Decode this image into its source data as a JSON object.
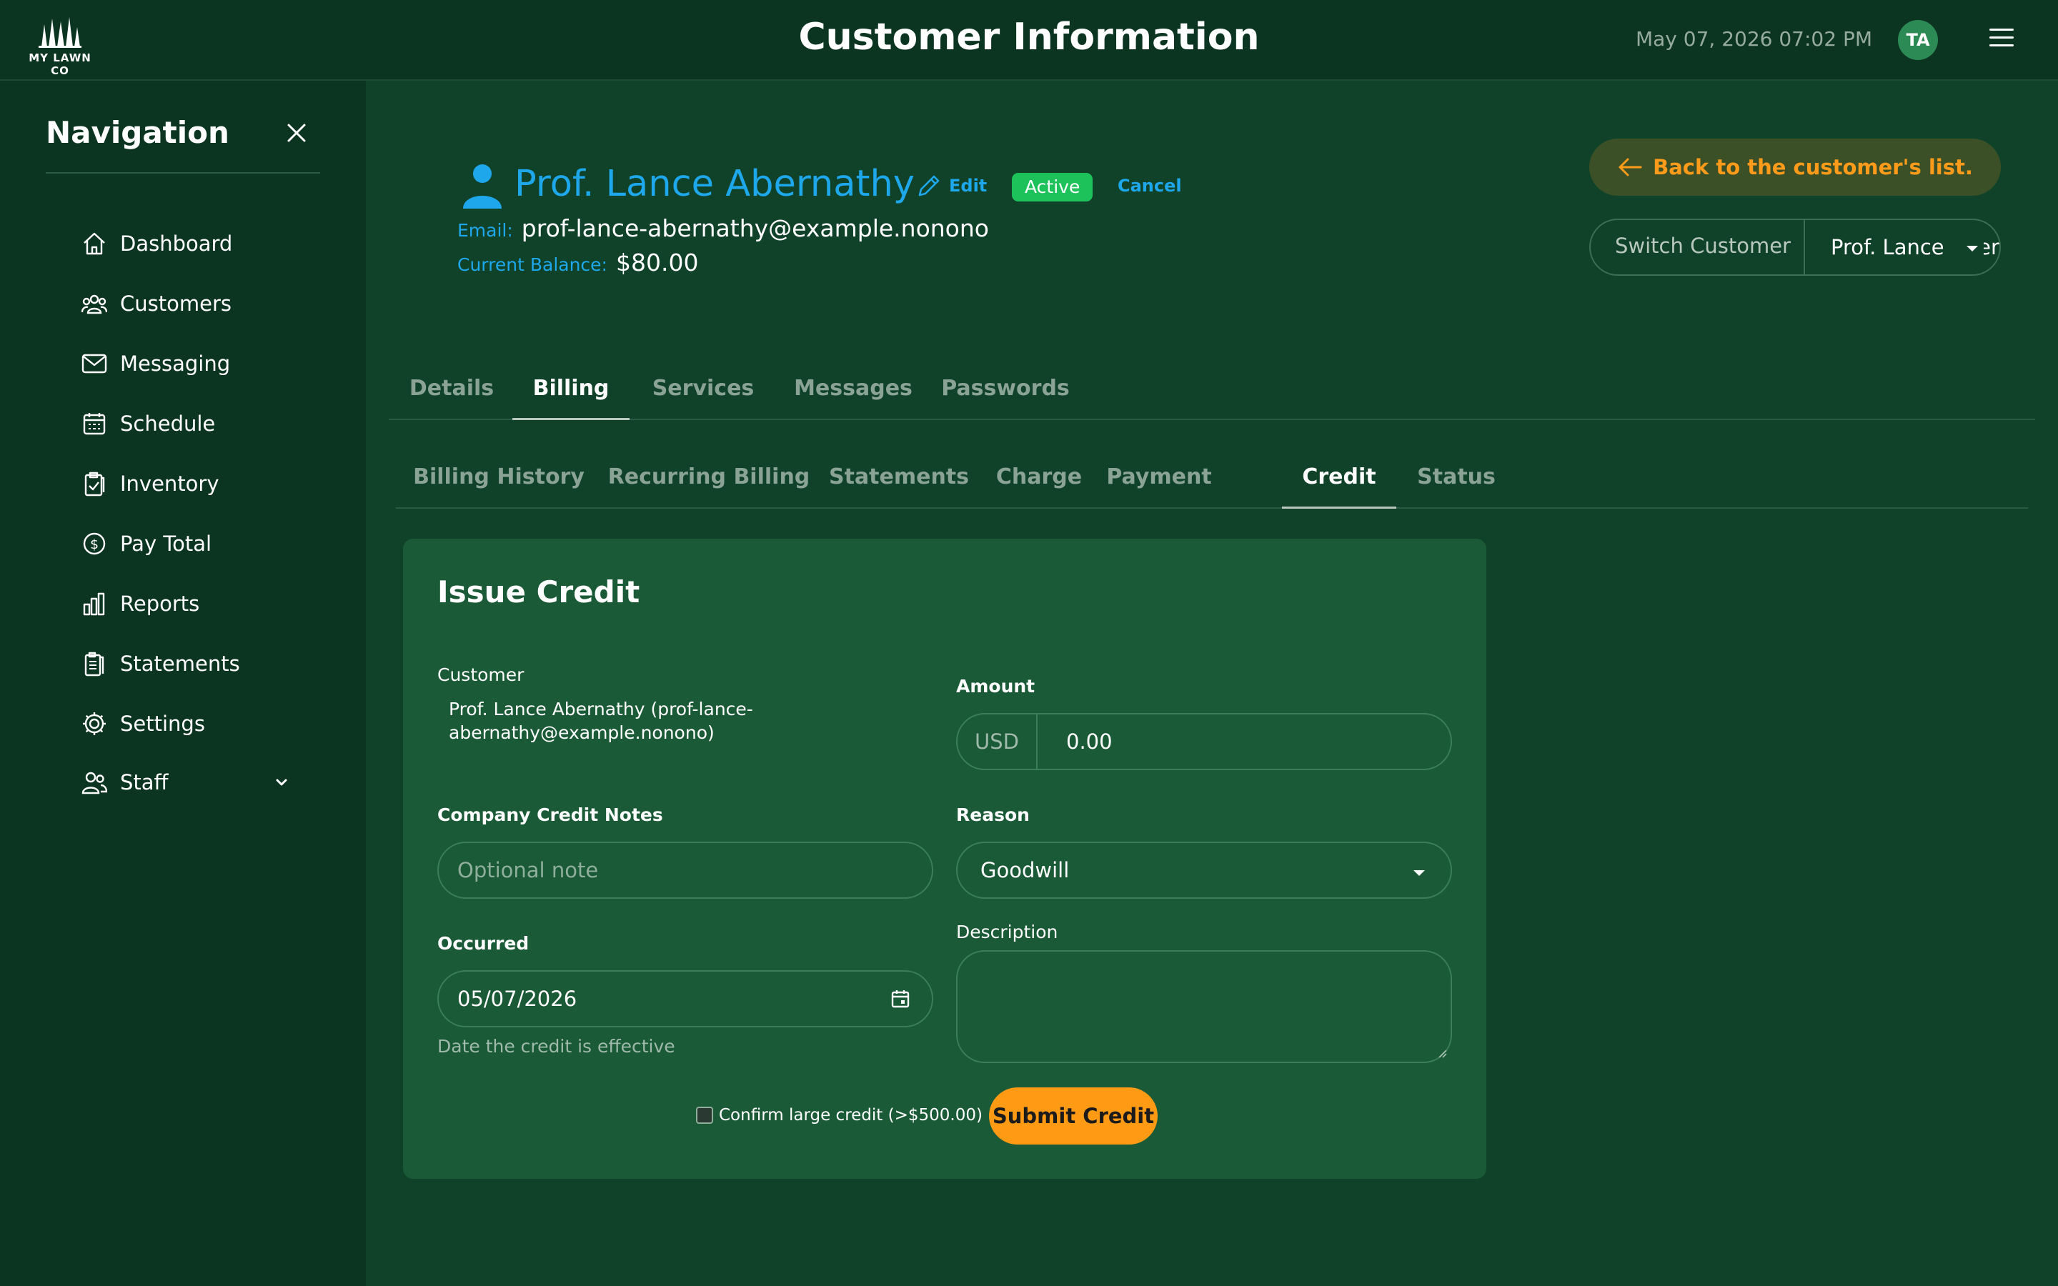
{
  "header": {
    "logo_text": "MY LAWN CO",
    "title": "Customer Information",
    "datetime": "May 07, 2026 07:02 PM",
    "avatar_initials": "TA"
  },
  "sidebar": {
    "title": "Navigation",
    "items": [
      {
        "label": "Dashboard",
        "icon": "home-icon"
      },
      {
        "label": "Customers",
        "icon": "users-icon"
      },
      {
        "label": "Messaging",
        "icon": "envelope-icon"
      },
      {
        "label": "Schedule",
        "icon": "calendar-icon"
      },
      {
        "label": "Inventory",
        "icon": "clipboard-check-icon"
      },
      {
        "label": "Pay Total",
        "icon": "dollar-circle-icon"
      },
      {
        "label": "Reports",
        "icon": "bar-chart-icon"
      },
      {
        "label": "Statements",
        "icon": "documents-icon"
      },
      {
        "label": "Settings",
        "icon": "gear-icon"
      },
      {
        "label": "Staff",
        "icon": "staff-icon"
      }
    ]
  },
  "customer": {
    "name": "Prof. Lance Abernathy",
    "edit_label": "Edit",
    "status": "Active",
    "cancel_label": "Cancel",
    "email_label": "Email:",
    "email": "prof-lance-abernathy@example.nonono",
    "balance_label": "Current Balance:",
    "balance": "$80.00"
  },
  "actions": {
    "back_label": "Back to the customer's list.",
    "switch_label": "Switch Customer",
    "switch_value": "Prof. Lance Abernathy"
  },
  "main_tabs": [
    {
      "label": "Details",
      "active": false
    },
    {
      "label": "Billing",
      "active": true
    },
    {
      "label": "Services",
      "active": false
    },
    {
      "label": "Messages",
      "active": false
    },
    {
      "label": "Passwords",
      "active": false
    }
  ],
  "sub_tabs": [
    {
      "label": "Billing History",
      "active": false
    },
    {
      "label": "Recurring Billing",
      "active": false
    },
    {
      "label": "Statements",
      "active": false
    },
    {
      "label": "Charge",
      "active": false
    },
    {
      "label": "Payment",
      "active": false
    },
    {
      "label": "Credit",
      "active": true
    },
    {
      "label": "Status",
      "active": false
    }
  ],
  "form": {
    "title": "Issue Credit",
    "customer_label": "Customer",
    "customer_value": "Prof. Lance Abernathy (prof-lance-abernathy@example.nonono)",
    "amount_label": "Amount",
    "currency": "USD",
    "amount_value": "0.00",
    "notes_label": "Company Credit Notes",
    "notes_placeholder": "Optional note",
    "reason_label": "Reason",
    "reason_value": "Goodwill",
    "occurred_label": "Occurred",
    "occurred_value": "05/07/2026",
    "occurred_help": "Date the credit is effective",
    "description_label": "Description",
    "confirm_label": "Confirm large credit (>$500.00)",
    "submit_label": "Submit Credit"
  },
  "colors": {
    "background": "#10422a",
    "topbar": "#0c3521",
    "card": "#1a5a37",
    "accent_blue": "#1ea7ea",
    "accent_orange": "#ff9a14",
    "status_green": "#1ec25b"
  }
}
